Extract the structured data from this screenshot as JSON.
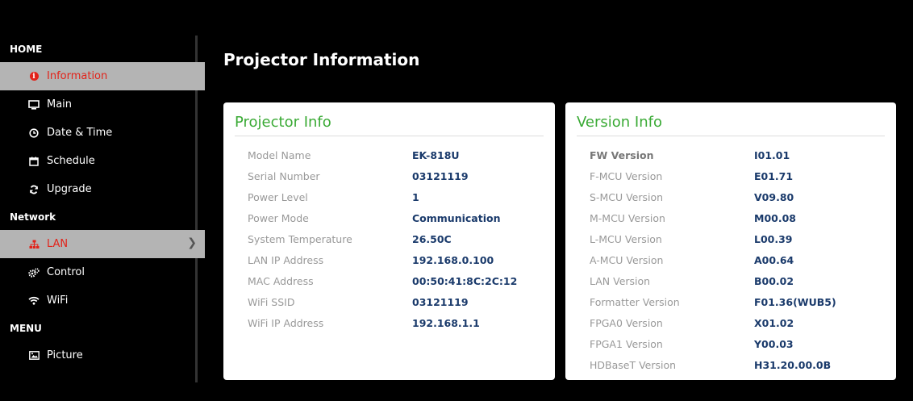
{
  "sidebar": {
    "home_label": "HOME",
    "network_label": "Network",
    "menu_label": "MENU",
    "items": [
      {
        "label": "Information",
        "icon": "info-circle-icon"
      },
      {
        "label": "Main",
        "icon": "monitor-icon"
      },
      {
        "label": "Date & Time",
        "icon": "clock-icon"
      },
      {
        "label": "Schedule",
        "icon": "calendar-icon"
      },
      {
        "label": "Upgrade",
        "icon": "refresh-icon"
      },
      {
        "label": "LAN",
        "icon": "sitemap-icon"
      },
      {
        "label": "Control",
        "icon": "gears-icon"
      },
      {
        "label": "WiFi",
        "icon": "wifi-icon"
      },
      {
        "label": "Picture",
        "icon": "image-icon"
      }
    ]
  },
  "page_title": "Projector Information",
  "projector_info": {
    "title": "Projector Info",
    "rows": [
      {
        "label": "Model Name",
        "value": "EK-818U"
      },
      {
        "label": "Serial Number",
        "value": "03121119"
      },
      {
        "label": "Power Level",
        "value": "1"
      },
      {
        "label": "Power Mode",
        "value": "Communication"
      },
      {
        "label": "System Temperature",
        "value": "26.50C"
      },
      {
        "label": "LAN IP Address",
        "value": "192.168.0.100"
      },
      {
        "label": "MAC Address",
        "value": "00:50:41:8C:2C:12"
      },
      {
        "label": "WiFi SSID",
        "value": "03121119"
      },
      {
        "label": "WiFi IP Address",
        "value": "192.168.1.1"
      }
    ]
  },
  "version_info": {
    "title": "Version Info",
    "rows": [
      {
        "label": "FW Version",
        "value": "I01.01"
      },
      {
        "label": "F-MCU Version",
        "value": "E01.71"
      },
      {
        "label": "S-MCU Version",
        "value": "V09.80"
      },
      {
        "label": "M-MCU Version",
        "value": "M00.08"
      },
      {
        "label": "L-MCU Version",
        "value": "L00.39"
      },
      {
        "label": "A-MCU Version",
        "value": "A00.64"
      },
      {
        "label": "LAN Version",
        "value": "B00.02"
      },
      {
        "label": "Formatter Version",
        "value": "F01.36(WUB5)"
      },
      {
        "label": "FPGA0 Version",
        "value": "X01.02"
      },
      {
        "label": "FPGA1 Version",
        "value": "Y00.03"
      },
      {
        "label": "HDBaseT Version",
        "value": "H31.20.00.0B"
      }
    ]
  },
  "colors": {
    "accent_red": "#e2231a",
    "title_green": "#3aaa35",
    "value_blue": "#1a3a6b"
  }
}
